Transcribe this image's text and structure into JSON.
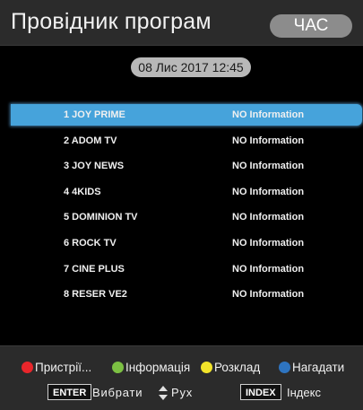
{
  "header": {
    "title": "Провідник програм",
    "time_button": "ЧАС"
  },
  "datetime": "08 Лис 2017 12:45",
  "channels": [
    {
      "label": "1 JOY PRIME",
      "info": "NO Information",
      "selected": true
    },
    {
      "label": "2 ADOM TV",
      "info": "NO Information"
    },
    {
      "label": "3 JOY NEWS",
      "info": "NO Information"
    },
    {
      "label": "4 4KIDS",
      "info": "NO Information"
    },
    {
      "label": "5 DOMINION TV",
      "info": "NO Information"
    },
    {
      "label": "6 ROCK TV",
      "info": "NO Information"
    },
    {
      "label": "7 CINE PLUS",
      "info": "NO Information"
    },
    {
      "label": "8 RESER VE2",
      "info": "NO Information"
    }
  ],
  "footer": {
    "color_keys": [
      {
        "label": "Пристрії...",
        "color": "#e8262b",
        "icon": "red-dot-icon"
      },
      {
        "label": "Інформація",
        "color": "#7cc043",
        "icon": "green-dot-icon"
      },
      {
        "label": "Розклад",
        "color": "#f2e42a",
        "icon": "yellow-dot-icon"
      },
      {
        "label": "Нагадати",
        "color": "#2e74c0",
        "icon": "blue-dot-icon"
      }
    ],
    "enter_key": "ENTER",
    "enter_label": "Вибрати",
    "move_icon": "up-down-arrows-icon",
    "move_label": "Рух",
    "index_key": "INDEX",
    "index_label": "Індекс"
  },
  "colors": {
    "highlight": "#46a3db",
    "panel": "#2b2b2b",
    "background": "#000000"
  }
}
